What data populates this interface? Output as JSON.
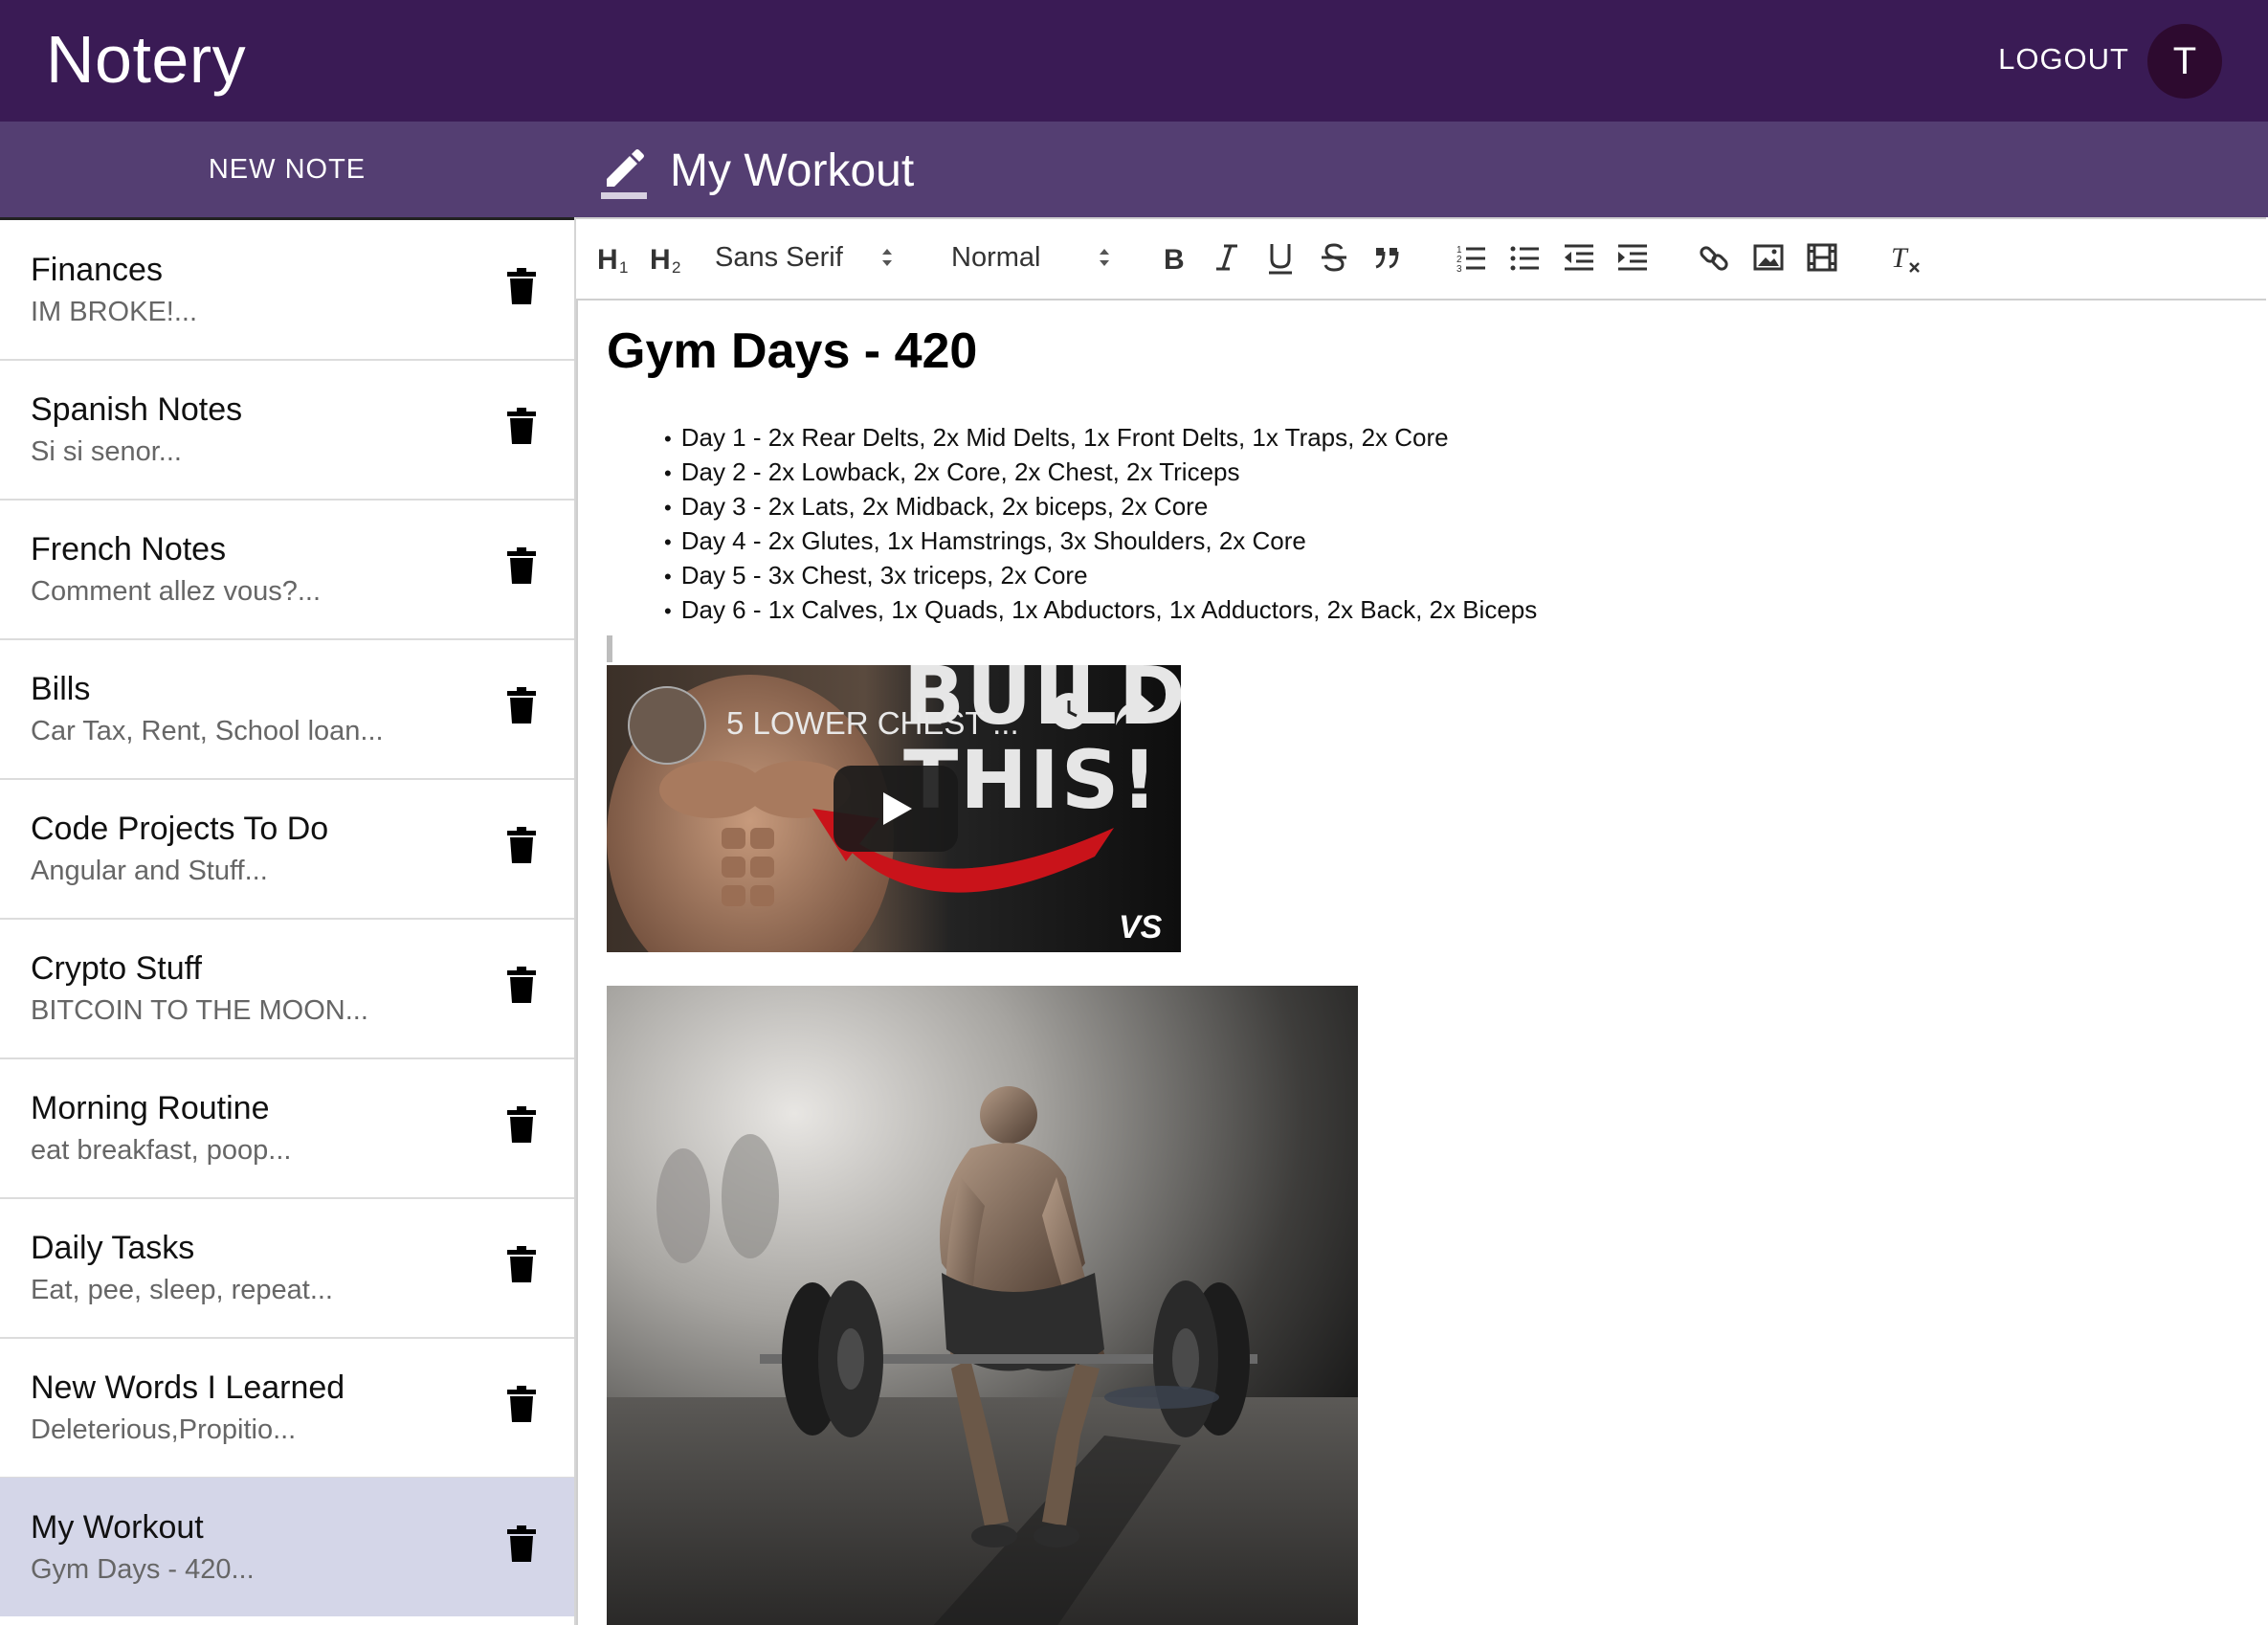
{
  "app": {
    "title": "Notery",
    "logout_label": "LOGOUT",
    "avatar_initial": "T"
  },
  "toolbar_top": {
    "new_note_label": "NEW NOTE",
    "current_note_title": "My Workout"
  },
  "notes": [
    {
      "title": "Finances",
      "preview": "IM BROKE!..."
    },
    {
      "title": "Spanish Notes",
      "preview": "Si si senor..."
    },
    {
      "title": "French Notes",
      "preview": "Comment allez vous?..."
    },
    {
      "title": "Bills",
      "preview": "Car Tax, Rent, School loan..."
    },
    {
      "title": "Code Projects To Do",
      "preview": "Angular and Stuff..."
    },
    {
      "title": "Crypto Stuff",
      "preview": "BITCOIN TO THE MOON..."
    },
    {
      "title": "Morning Routine",
      "preview": "eat breakfast, poop..."
    },
    {
      "title": "Daily Tasks",
      "preview": "Eat, pee, sleep, repeat..."
    },
    {
      "title": "New Words I Learned",
      "preview": "Deleterious,Propitio..."
    },
    {
      "title": "My Workout",
      "preview": "Gym Days - 420...",
      "selected": true
    }
  ],
  "editor_toolbar": {
    "h1": "H1",
    "h2": "H2",
    "font": "Sans Serif",
    "size": "Normal"
  },
  "document": {
    "heading": "Gym Days - 420",
    "days": [
      "Day 1 - 2x Rear Delts, 2x Mid Delts, 1x Front Delts, 1x Traps, 2x Core",
      "Day 2 - 2x Lowback, 2x Core, 2x Chest, 2x Triceps",
      "Day 3 - 2x Lats, 2x Midback, 2x biceps, 2x Core",
      "Day 4 - 2x Glutes, 1x Hamstrings, 3x Shoulders, 2x Core",
      "Day 5 - 3x Chest, 3x triceps, 2x Core",
      "Day 6 - 1x Calves, 1x Quads, 1x Abductors, 1x Adductors, 2x Back, 2x Biceps"
    ],
    "video": {
      "title": "5 LOWER CHEST ...",
      "overlay_line1": "BUILD",
      "overlay_line2": "THIS!",
      "channel_logo": "VS"
    }
  },
  "colors": {
    "appbar": "#3a1b55",
    "subbar": "#543e72",
    "selected_note": "#d4d6e8",
    "avatar": "#2d0a2f"
  }
}
